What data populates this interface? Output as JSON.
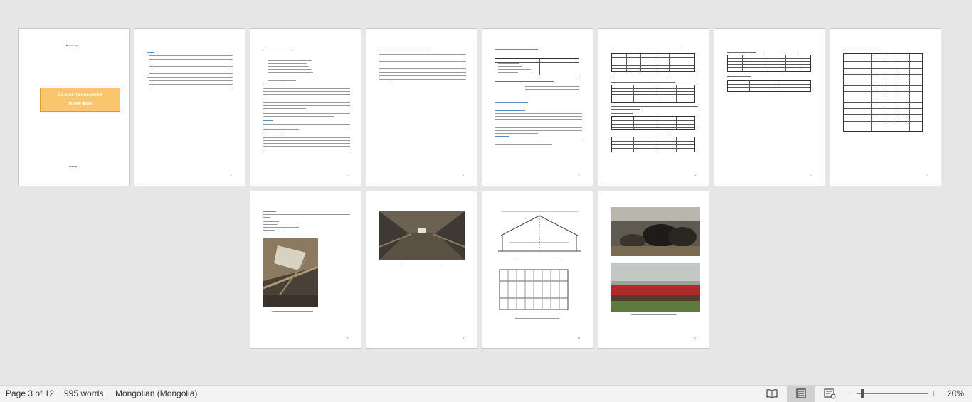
{
  "document": {
    "cover_heading": "Малчин суз",
    "cover_title": "Бизнес төлөвлөгөө",
    "cover_subtitle": "Үхрийн ферм",
    "cover_year": "2019 он"
  },
  "statusbar": {
    "page_info": "Page 3 of 12",
    "word_count": "995 words",
    "language": "Mongolian (Mongolia)",
    "zoom_level": "20%",
    "zoom_minus": "−",
    "zoom_plus": "+"
  },
  "icons": {
    "read_mode": "read-mode-icon",
    "print_layout": "print-layout-icon",
    "web_layout": "web-layout-icon"
  },
  "colors": {
    "cover_fill": "#f9c66e",
    "heading_blue": "#5b8dc4",
    "statusbar_bg": "#f3f3f3"
  }
}
